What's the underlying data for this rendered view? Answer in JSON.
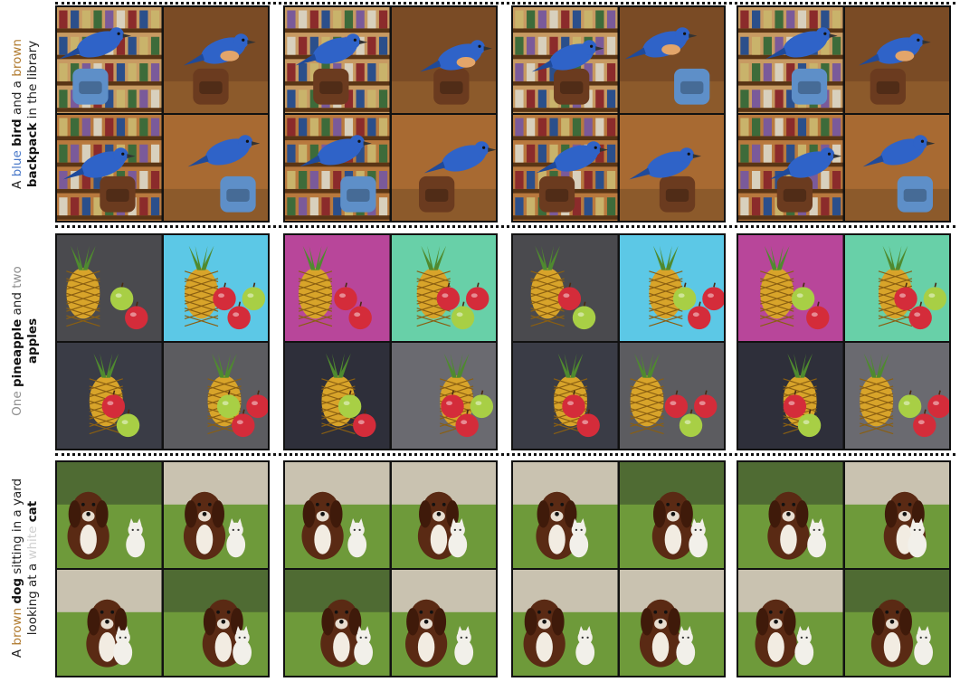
{
  "captions": [
    {
      "segments_line1": [
        {
          "text": "A ",
          "style": "plain"
        },
        {
          "text": "blue",
          "style": "blue"
        },
        {
          "text": " ",
          "style": "plain"
        },
        {
          "text": "bird",
          "style": "bold"
        },
        {
          "text": " and a ",
          "style": "plain"
        },
        {
          "text": "brown",
          "style": "brown"
        }
      ],
      "segments_line2": [
        {
          "text": "backpack",
          "style": "bold"
        },
        {
          "text": " in the library",
          "style": "plain"
        }
      ]
    },
    {
      "segments_line1": [
        {
          "text": "One ",
          "style": "grey"
        },
        {
          "text": "pineapple",
          "style": "bold"
        },
        {
          "text": " and ",
          "style": "plain"
        },
        {
          "text": "two",
          "style": "grey"
        }
      ],
      "segments_line2": [
        {
          "text": "apples",
          "style": "bold"
        }
      ]
    },
    {
      "segments_line1": [
        {
          "text": "A ",
          "style": "plain"
        },
        {
          "text": "brown",
          "style": "brown"
        },
        {
          "text": " ",
          "style": "plain"
        },
        {
          "text": "dog",
          "style": "bold"
        },
        {
          "text": " sitting in a yard",
          "style": "plain"
        }
      ],
      "segments_line2": [
        {
          "text": "looking at a ",
          "style": "plain"
        },
        {
          "text": "white",
          "style": "white"
        },
        {
          "text": " ",
          "style": "plain"
        },
        {
          "text": "cat",
          "style": "bold"
        }
      ]
    }
  ],
  "scene_types": [
    "bird-backpack-library",
    "pineapple-apples",
    "dog-cat-yard"
  ],
  "palette": {
    "library_wood": "#8a5a2e",
    "bird_blue": "#2f63c8",
    "backpack_brown": "#6b3b1f",
    "pineapple_yellow": "#d8a42a",
    "pineapple_leaf": "#4f8a2f",
    "apple_red": "#d42c3a",
    "apple_green": "#a8cf45",
    "grass_green": "#6e9a3a",
    "dog_brown": "#5a2a14",
    "cat_white": "#f2f0ea"
  }
}
